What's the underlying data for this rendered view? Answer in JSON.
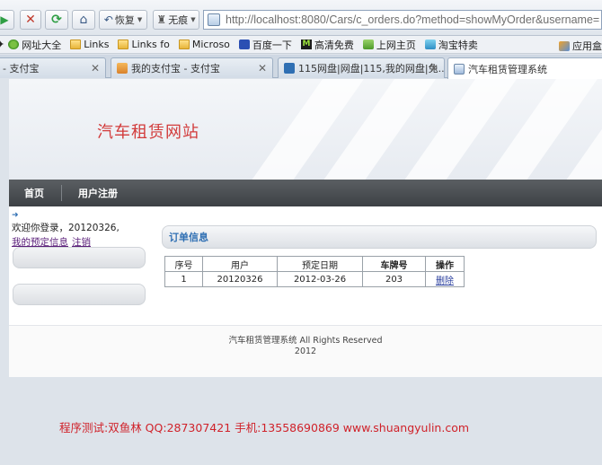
{
  "browser": {
    "toolbar": {
      "restore_label": "恢复",
      "noimage_label": "无痕"
    },
    "address_url": "http://localhost:8080/Cars/c_orders.do?method=showMyOrder&username=",
    "bookmarks": [
      {
        "label": "网址大全"
      },
      {
        "label": "Links"
      },
      {
        "label": "Links fo"
      },
      {
        "label": "Microso"
      },
      {
        "label": "百度一下"
      },
      {
        "label": "高清免费"
      },
      {
        "label": "上网主页"
      },
      {
        "label": "淘宝特卖"
      }
    ],
    "bookmark_apps": "应用盒",
    "tabs": [
      {
        "label": "- 支付宝"
      },
      {
        "label": "我的支付宝 - 支付宝"
      },
      {
        "label": "115网盘|网盘|115,我的网盘|免..."
      },
      {
        "label": "汽车租赁管理系统"
      }
    ]
  },
  "site": {
    "title": "汽车租赁网站",
    "nav": [
      "首页",
      "用户注册"
    ],
    "welcome": "欢迎你登录，20120326,",
    "links": [
      "我的预定信息",
      "注销"
    ],
    "orders": {
      "header": "订单信息",
      "columns": [
        "序号",
        "用户",
        "预定日期",
        "车牌号",
        "操作"
      ],
      "rows": [
        {
          "no": "1",
          "user": "20120326",
          "date": "2012-03-26",
          "plate": "203",
          "action": "删除"
        }
      ]
    },
    "footer": {
      "line1": "汽车租赁管理系统  All Rights Reserved",
      "line2": "2012"
    }
  },
  "bottom_note": "程序测试:双鱼林 QQ:287307421 手机:13558690869 www.shuangyulin.com"
}
